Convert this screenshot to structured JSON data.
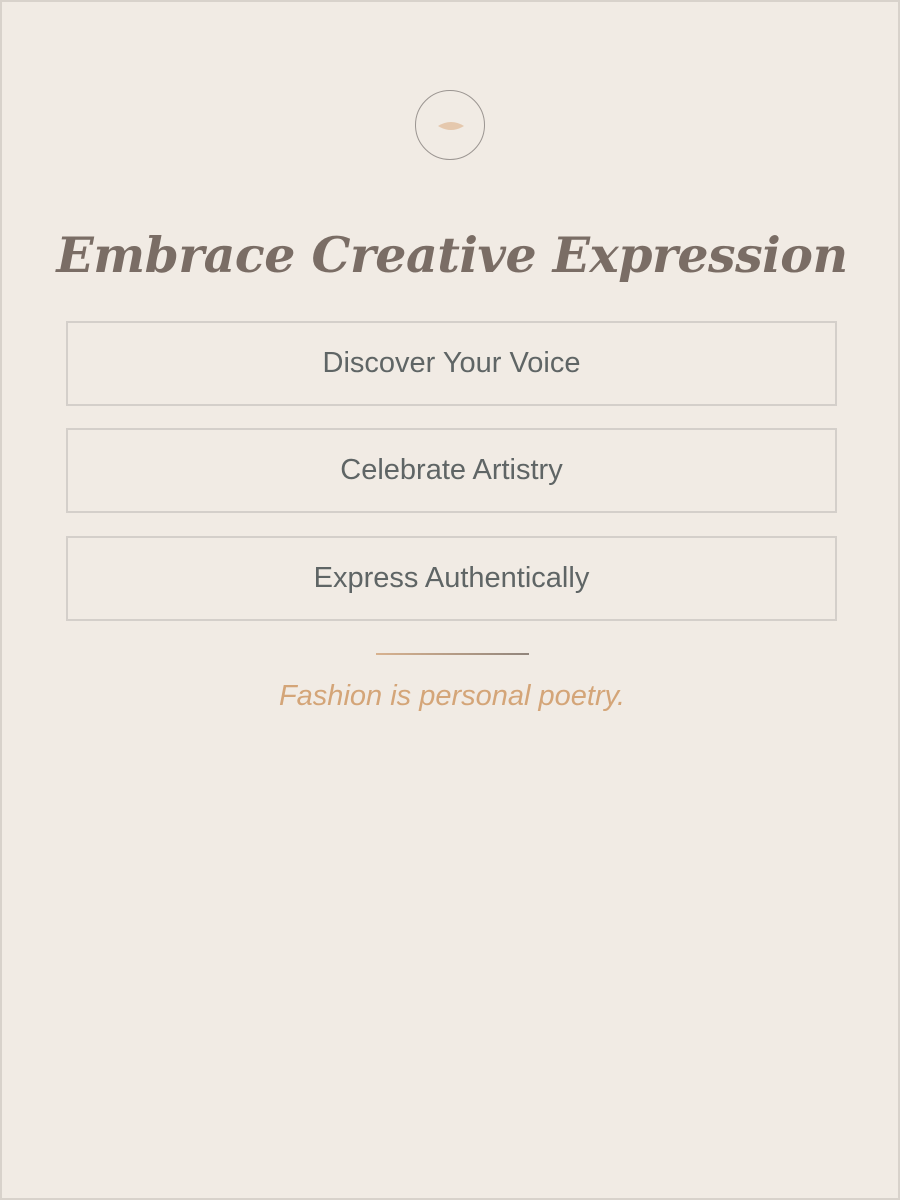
{
  "brand": {
    "icon": "eye-icon",
    "colors": {
      "background": "#f1ebe4",
      "title": "#7a6d65",
      "button_text": "#5f6565",
      "button_border": "#d4cfca",
      "accent": "#d4a578",
      "icon_ring": "#9b9591",
      "icon_fill": "#e5c8ad"
    }
  },
  "page_title": "Embrace Creative Expression",
  "buttons": [
    {
      "label": "Discover Your Voice"
    },
    {
      "label": "Celebrate Artistry"
    },
    {
      "label": "Express Authentically"
    }
  ],
  "tagline": "Fashion is personal poetry."
}
